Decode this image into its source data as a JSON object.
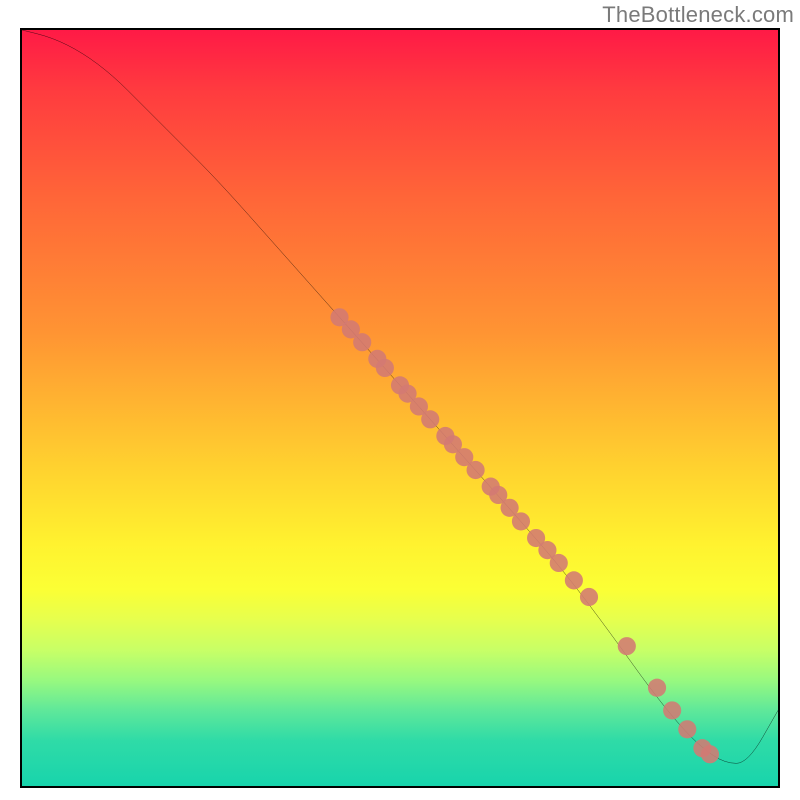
{
  "watermark": "TheBottleneck.com",
  "chart_data": {
    "type": "line",
    "title": "",
    "xlabel": "",
    "ylabel": "",
    "xlim": [
      0,
      100
    ],
    "ylim": [
      0,
      100
    ],
    "grid": false,
    "series": [
      {
        "name": "curve",
        "color": "#000000",
        "x": [
          0,
          4,
          8,
          12,
          16,
          20,
          26,
          34,
          42,
          50,
          58,
          66,
          72,
          78,
          83,
          87,
          90,
          93,
          96,
          100
        ],
        "y": [
          100,
          99,
          97,
          94,
          90,
          86,
          80,
          71,
          62,
          53,
          44,
          35,
          28,
          20,
          13,
          8,
          5,
          3,
          3,
          10
        ]
      }
    ],
    "points": {
      "name": "markers",
      "color": "#d37a73",
      "radius": 1.2,
      "x": [
        42,
        43.5,
        45,
        47,
        48,
        50,
        51,
        52.5,
        54,
        56,
        57,
        58.5,
        60,
        62,
        63,
        64.5,
        66,
        68,
        69.5,
        71,
        73,
        75,
        80,
        84,
        86,
        88,
        90,
        91
      ],
      "y": [
        62,
        60.4,
        58.7,
        56.5,
        55.3,
        53,
        51.9,
        50.2,
        48.5,
        46.3,
        45.2,
        43.5,
        41.8,
        39.6,
        38.5,
        36.8,
        35,
        32.8,
        31.2,
        29.5,
        27.2,
        25,
        18.5,
        13,
        10,
        7.5,
        5,
        4.2
      ]
    },
    "background_gradient": {
      "type": "vertical",
      "stops": [
        {
          "pos": 0.0,
          "color": "#ff1a46"
        },
        {
          "pos": 0.08,
          "color": "#ff3b3f"
        },
        {
          "pos": 0.22,
          "color": "#ff6538"
        },
        {
          "pos": 0.4,
          "color": "#ff9433"
        },
        {
          "pos": 0.58,
          "color": "#ffd22f"
        },
        {
          "pos": 0.68,
          "color": "#fff22f"
        },
        {
          "pos": 0.74,
          "color": "#fbff35"
        },
        {
          "pos": 0.78,
          "color": "#e6ff4e"
        },
        {
          "pos": 0.82,
          "color": "#c8ff66"
        },
        {
          "pos": 0.86,
          "color": "#98f97f"
        },
        {
          "pos": 0.9,
          "color": "#5fe89a"
        },
        {
          "pos": 0.94,
          "color": "#2fdba7"
        },
        {
          "pos": 1.0,
          "color": "#18d4ac"
        }
      ]
    }
  }
}
